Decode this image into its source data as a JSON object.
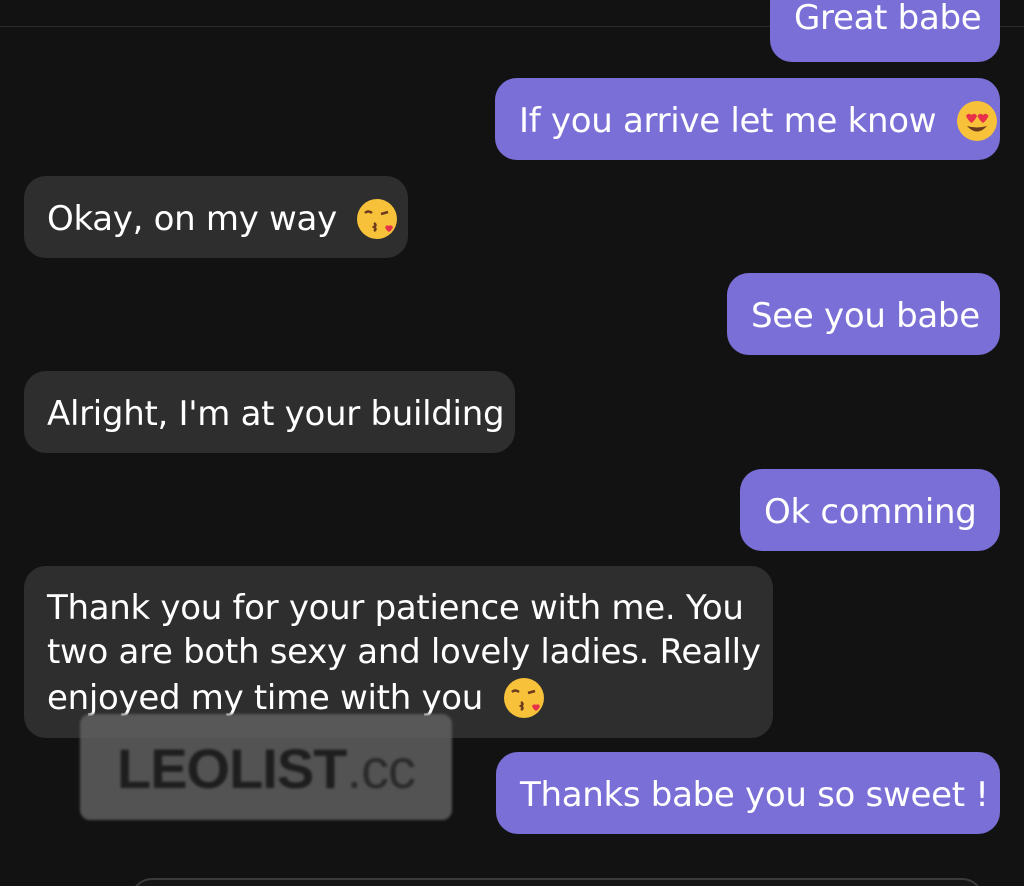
{
  "messages": [
    {
      "id": "m0",
      "side": "sent",
      "text": "Great babe",
      "emoji": ""
    },
    {
      "id": "m1",
      "side": "sent",
      "text": "If you arrive let me know",
      "emoji": "heart-eyes-emoji"
    },
    {
      "id": "m2",
      "side": "received",
      "text": "Okay, on my way",
      "emoji": "kiss-emoji"
    },
    {
      "id": "m3",
      "side": "sent",
      "text": "See you babe",
      "emoji": ""
    },
    {
      "id": "m4",
      "side": "received",
      "text": "Alright, I'm at your building",
      "emoji": ""
    },
    {
      "id": "m5",
      "side": "sent",
      "text": "Ok comming",
      "emoji": ""
    },
    {
      "id": "m6",
      "side": "received",
      "lines": [
        "Thank you for your patience with me. You",
        "two are both sexy and lovely ladies. Really",
        "enjoyed my time with you"
      ],
      "emoji": "kiss-emoji"
    },
    {
      "id": "m7",
      "side": "sent",
      "text": "Thanks babe you so sweet !",
      "emoji": ""
    }
  ],
  "watermark": {
    "brand": "LEOLIST",
    "suffix": ".cc"
  },
  "colors": {
    "background": "#121212",
    "sent_bubble": "#7a6fd6",
    "received_bubble": "#2e2e2e",
    "text": "#ffffff"
  }
}
